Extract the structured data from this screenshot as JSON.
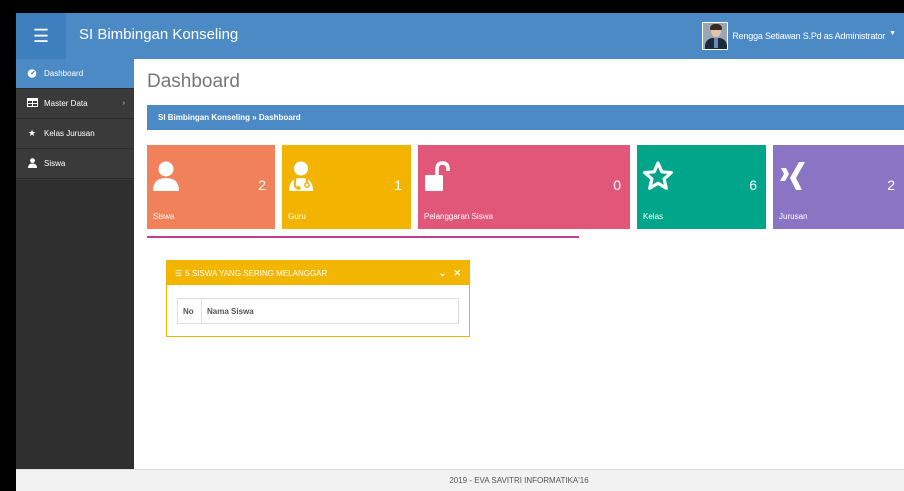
{
  "header": {
    "menu_icon": "hamburger-icon",
    "title": "SI Bimbingan Konseling",
    "user": "Rengga Setiawan S.Pd as Administrator",
    "accent": "#4c8ac6"
  },
  "sidebar": {
    "items": [
      {
        "label": "Dashboard",
        "icon": "dashboard-icon",
        "active": true
      },
      {
        "label": "Master Data",
        "icon": "table-icon",
        "has_children": true
      },
      {
        "label": "Kelas Jurusan",
        "icon": "star-icon"
      },
      {
        "label": "Siswa",
        "icon": "user-icon"
      }
    ]
  },
  "main": {
    "page_title": "Dashboard",
    "breadcrumb": "SI Bimbingan Konseling » Dashboard",
    "cards": [
      {
        "label": "Siswa",
        "count": "2",
        "icon": "user-icon",
        "color": "#f0815a"
      },
      {
        "label": "Guru",
        "count": "1",
        "icon": "doctor-icon",
        "color": "#f3b400"
      },
      {
        "label": "Pelanggaran Siswa",
        "count": "0",
        "icon": "unlock-icon",
        "color": "#e0577a"
      },
      {
        "label": "Kelas",
        "count": "6",
        "icon": "star-icon",
        "color": "#00a58a"
      },
      {
        "label": "Jurusan",
        "count": "2",
        "icon": "xing-icon",
        "color": "#8a75c4"
      }
    ],
    "widget": {
      "title": "5 SISWA YANG SERING MELANGGAR",
      "columns": [
        "No",
        "Nama Siswa"
      ],
      "color": "#f2b500"
    }
  },
  "footer": {
    "text": "2019 - EVA SAVITRI INFORMATIKA'16"
  }
}
